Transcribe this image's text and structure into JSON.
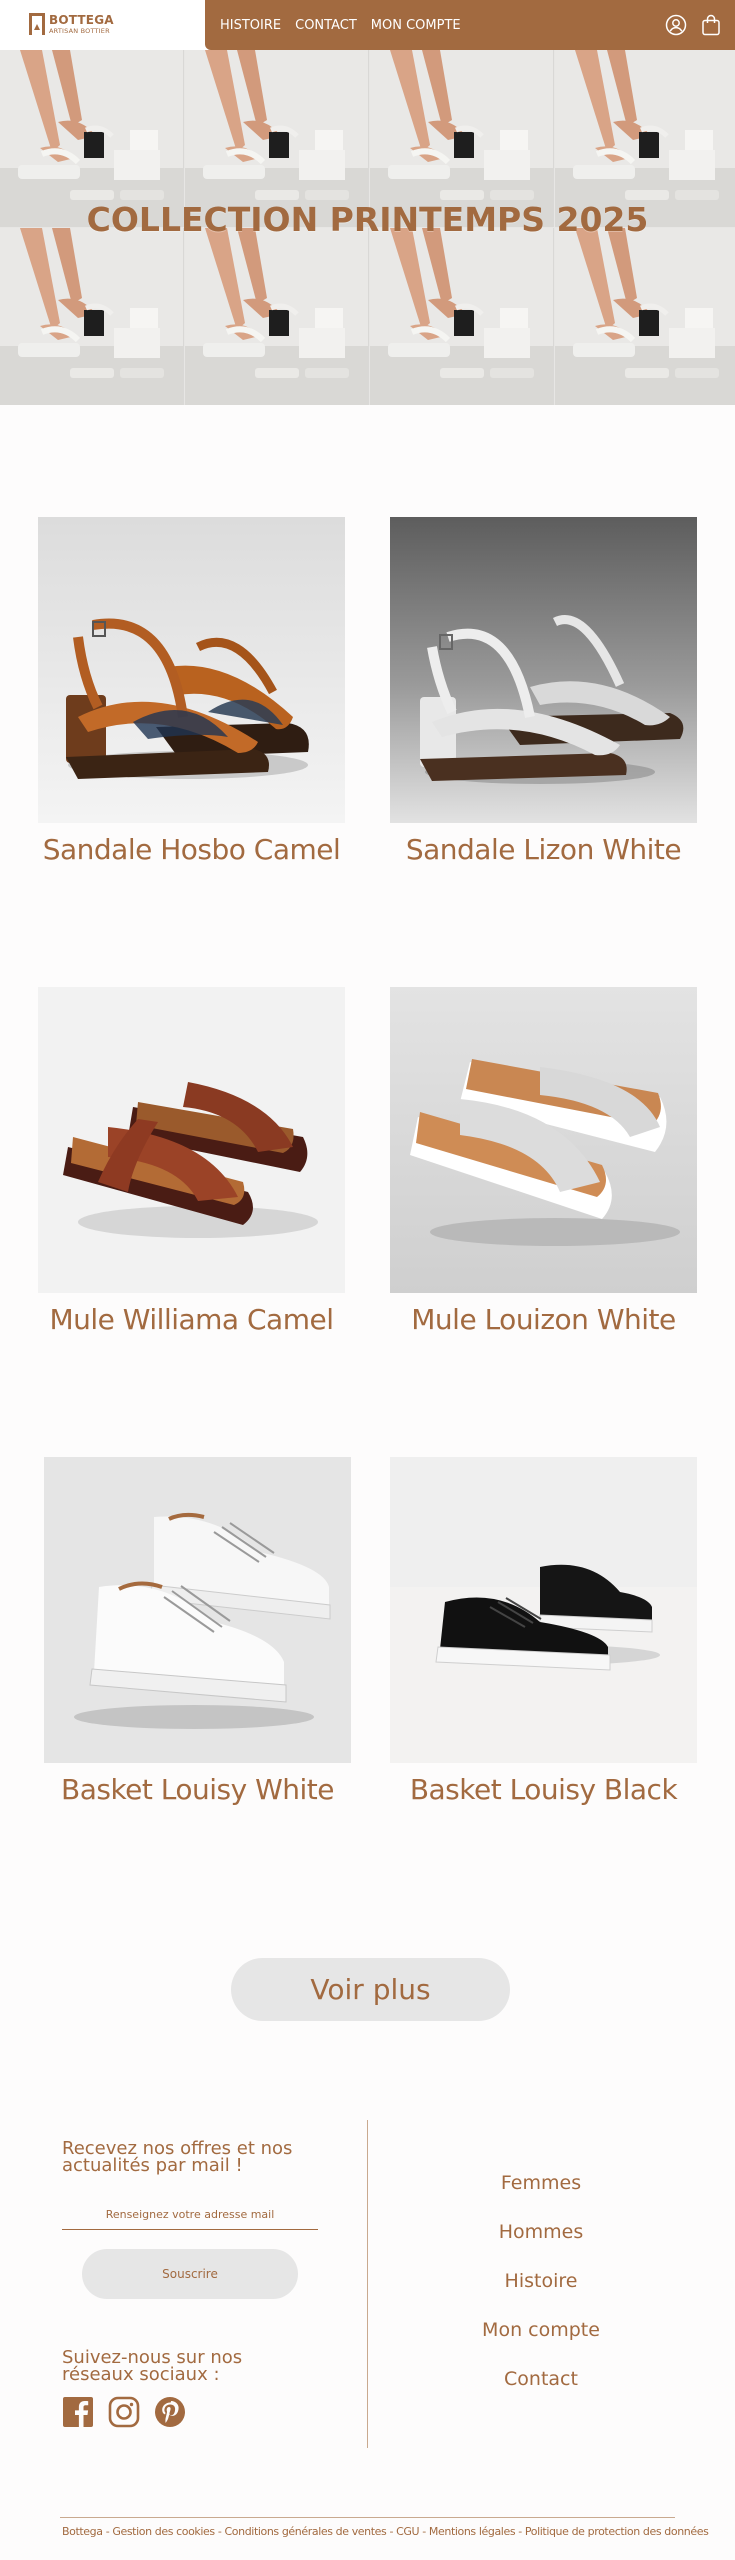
{
  "brand": {
    "name": "BOTTEGA",
    "tagline": "ARTISAN BOTTIER"
  },
  "nav": {
    "links": [
      "HISTOIRE",
      "CONTACT",
      "MON COMPTE"
    ],
    "icons": [
      "account-icon",
      "shopping-bag-icon"
    ]
  },
  "hero": {
    "title": "COLLECTION PRINTEMPS 2025"
  },
  "products": [
    {
      "name": "Sandale Hosbo Camel"
    },
    {
      "name": "Sandale Lizon White"
    },
    {
      "name": "Mule Williama Camel"
    },
    {
      "name": "Mule Louizon White"
    },
    {
      "name": "Basket Louisy White"
    },
    {
      "name": "Basket Louisy Black"
    }
  ],
  "more_button": "Voir plus",
  "footer": {
    "newsletter_title": "Recevez nos offres et nos actualités par mail !",
    "email_placeholder": "Renseignez votre adresse mail",
    "subscribe_label": "Souscrire",
    "social_title": "Suivez-nous sur nos réseaux sociaux :",
    "social_icons": [
      "facebook-icon",
      "instagram-icon",
      "pinterest-icon"
    ],
    "links": [
      "Femmes",
      "Hommes",
      "Histoire",
      "Mon compte",
      "Contact"
    ],
    "legal": "Bottega - Gestion des cookies - Conditions générales de ventes - CGU - Mentions légales - Politique de protection des données"
  },
  "colors": {
    "brand": "#a26a40",
    "button_bg": "#e6e6e6",
    "page_bg": "#fdfcfc"
  }
}
